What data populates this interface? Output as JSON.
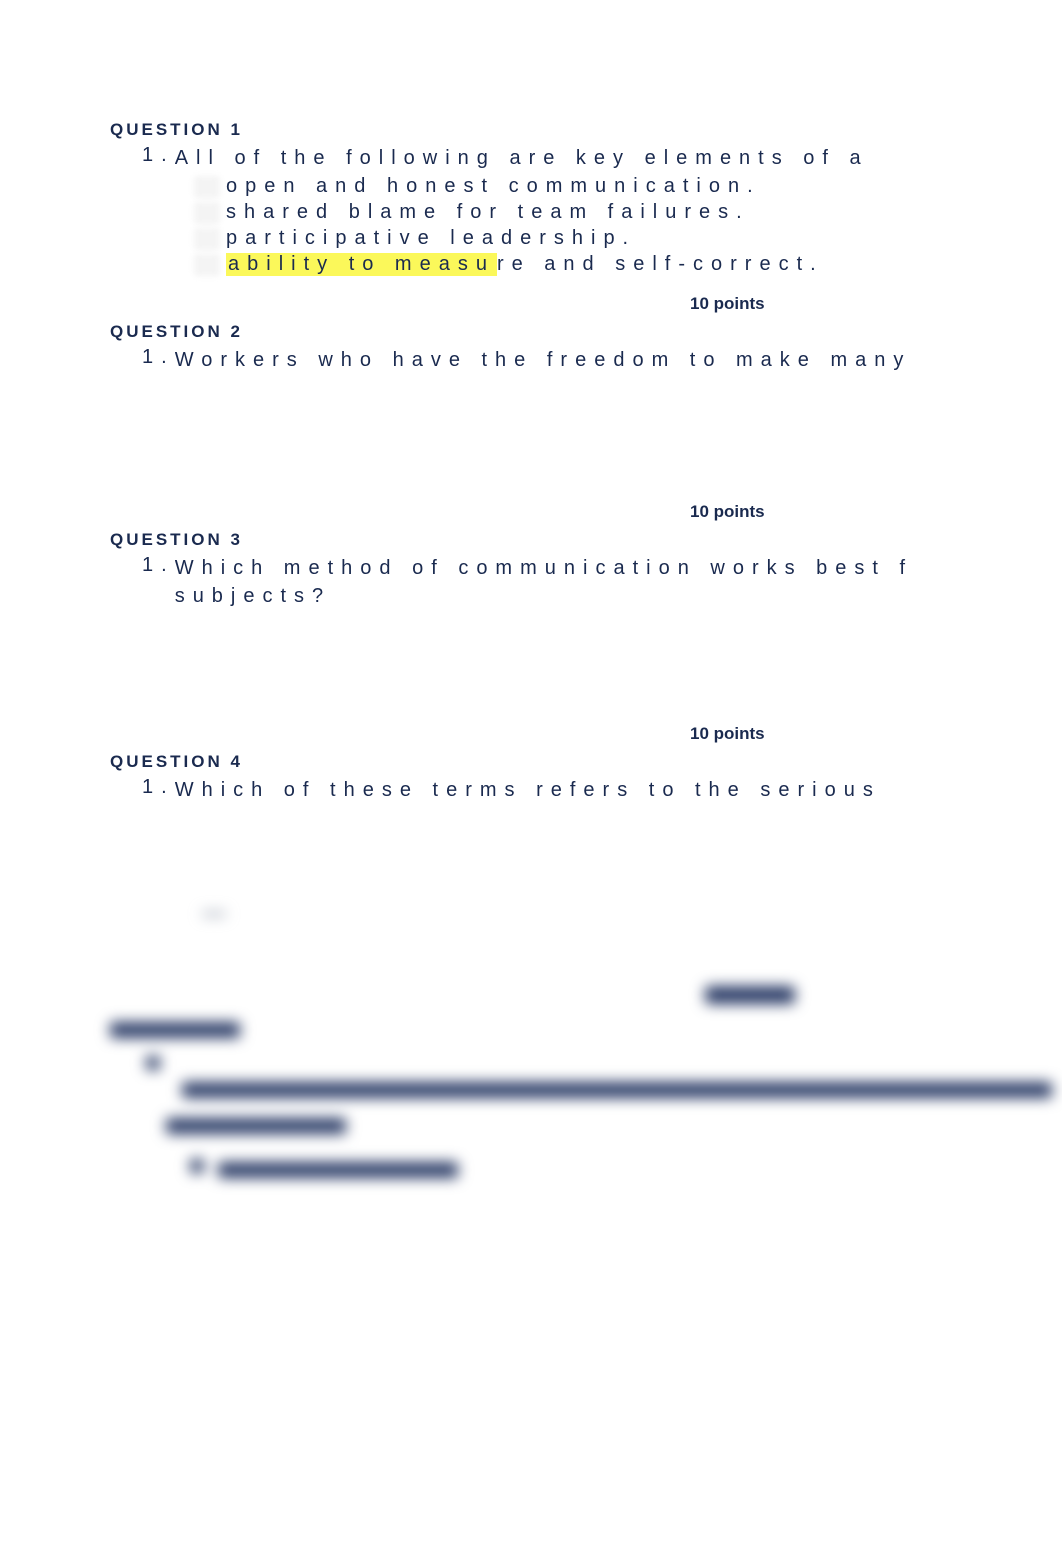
{
  "questions": [
    {
      "header": "QUESTION 1",
      "number": "1.",
      "stem": "All of the following are key elements of a",
      "options": [
        {
          "text": "open and honest communication.",
          "highlighted": false
        },
        {
          "text": "shared blame for team failures.",
          "highlighted": false
        },
        {
          "text": "participative leadership.",
          "highlighted": false
        },
        {
          "text_hl": "ability to measu",
          "text_rest": "re and self-correct.",
          "highlighted": true
        }
      ],
      "points": "10 points"
    },
    {
      "header": "QUESTION 2",
      "number": "1.",
      "stem": "Workers who have the freedom to make many",
      "options": [],
      "points": "10 points"
    },
    {
      "header": "QUESTION 3",
      "number": "1.",
      "stem": "Which method of communication works best f",
      "stem2": "subjects?",
      "options": [],
      "points": "10 points"
    },
    {
      "header": "QUESTION 4",
      "number": "1.",
      "stem": "Which of these terms refers to the serious",
      "options": [],
      "points": ""
    }
  ]
}
